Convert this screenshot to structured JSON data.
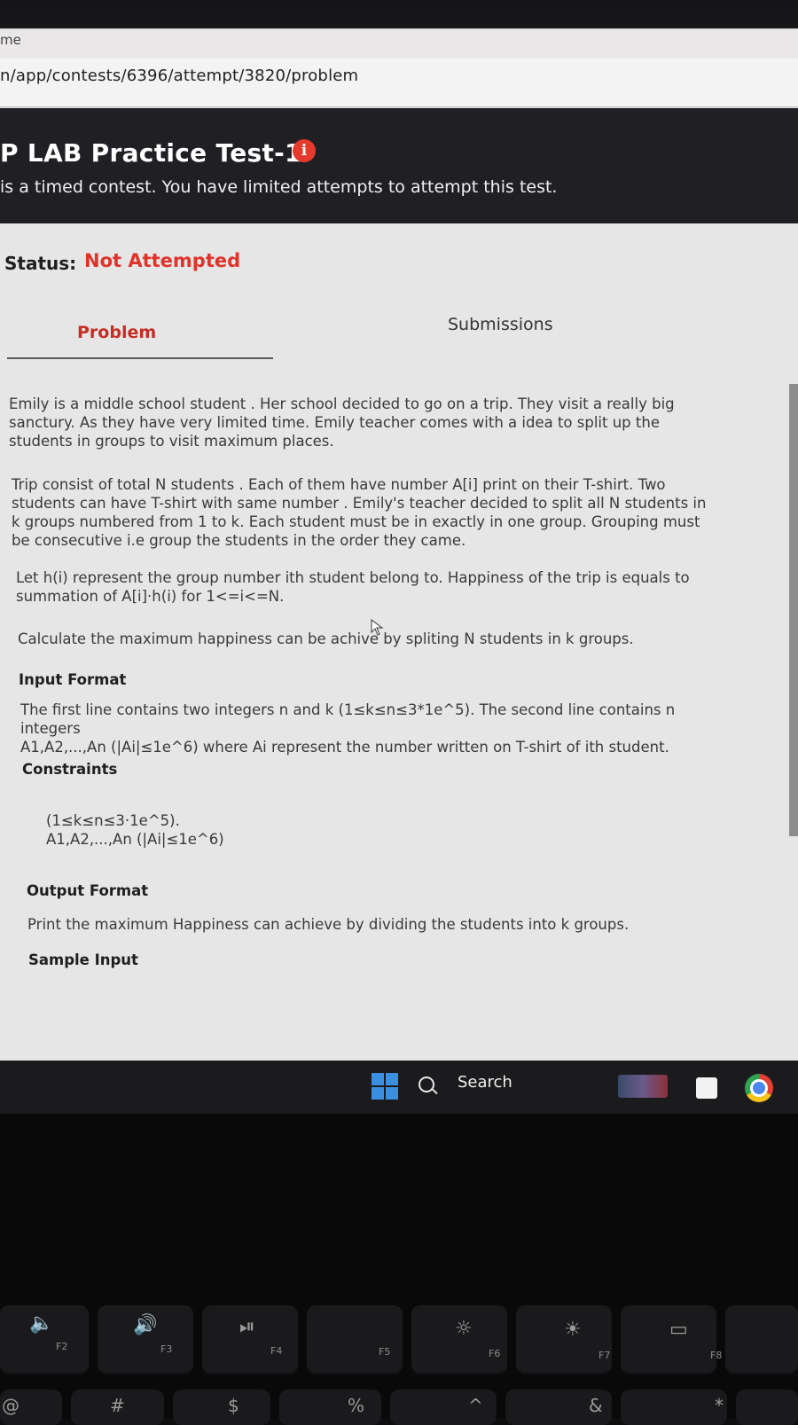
{
  "browser": {
    "tab_title": "me",
    "url": "n/app/contests/6396/attempt/3820/problem"
  },
  "contest": {
    "title": "P LAB Practice Test-1",
    "info_glyph": "i",
    "subtitle": "is a timed contest. You have limited attempts to attempt this test."
  },
  "status": {
    "label": "Status:",
    "value": "Not Attempted",
    "value_color": "#e0342b"
  },
  "tabs": {
    "problem": "Problem",
    "submissions": "Submissions"
  },
  "problem": {
    "p1_lines": [
      "Emily is a middle school student . Her school decided to go on a trip. They visit a really big",
      "sanctury. As they have very limited time. Emily teacher comes with a idea to split up the",
      "students in groups to visit maximum places."
    ],
    "p2_lines": [
      "Trip consist of total N students . Each of them have number A[i] print on their T-shirt. Two",
      "students can have T-shirt with same number . Emily's teacher decided to split all N students in",
      "k groups numbered from 1 to k. Each student must be in exactly in one group. Grouping must",
      "be consecutive i.e group the students in the order they came."
    ],
    "p3_lines": [
      "Let h(i) represent the group number ith student belong to. Happiness of the trip is equals to",
      "summation of A[i]·h(i) for 1<=i<=N."
    ],
    "p4": "Calculate the maximum happiness can be achive by spliting N students in k groups.",
    "input_heading": "Input Format",
    "input_lines": [
      "The first line contains two integers n and k (1≤k≤n≤3*1e^5). The second line contains n integers",
      "A1,A2,...,An (|Ai|≤1e^6) where Ai represent the number written on T-shirt of ith student."
    ],
    "constraints_heading": "Constraints",
    "constraints_lines": [
      "(1≤k≤n≤3·1e^5).",
      "A1,A2,...,An (|Ai|≤1e^6)"
    ],
    "output_heading": "Output Format",
    "output_text": "Print the maximum Happiness can achieve by dividing the students into k groups.",
    "sample_heading": "Sample Input"
  },
  "taskbar": {
    "search_label": "Search"
  },
  "keyboard": {
    "fkeys": [
      {
        "glyph": "🔈",
        "label": "F2"
      },
      {
        "glyph": "🔊",
        "label": "F3"
      },
      {
        "glyph": "⏯",
        "label": "F4"
      },
      {
        "glyph": "",
        "label": "F5"
      },
      {
        "glyph": "☼",
        "label": "F6"
      },
      {
        "glyph": "☀",
        "label": "F7"
      },
      {
        "glyph": "▭",
        "label": "F8"
      }
    ],
    "row2": [
      "@",
      "#",
      "$",
      "%",
      "^",
      "&",
      "*"
    ]
  }
}
